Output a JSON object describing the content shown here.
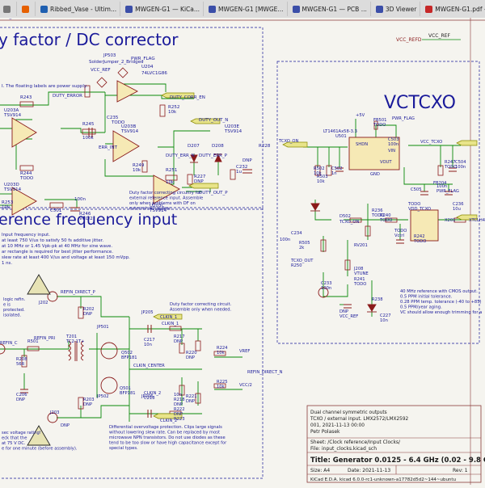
{
  "taskbar": {
    "items": [
      {
        "label": "",
        "icon": "window-icon",
        "color": "#777777"
      },
      {
        "label": "",
        "icon": "firefox-icon",
        "color": "#e66000"
      },
      {
        "label": "Ribbed_Vase - Ultim...",
        "icon": "ultimaker-icon",
        "color": "#1f5fb0"
      },
      {
        "label": "MWGEN-G1 — KiCa...",
        "icon": "kicad-icon",
        "color": "#3b4ea8"
      },
      {
        "label": "MWGEN-G1 [MWGE...",
        "icon": "kicad-icon",
        "color": "#3b4ea8"
      },
      {
        "label": "MWGEN-G1 — PCB ...",
        "icon": "kicad-icon",
        "color": "#3b4ea8"
      },
      {
        "label": "3D Viewer",
        "icon": "kicad-icon",
        "color": "#3b4ea8"
      },
      {
        "label": "MWGEN-G1.pdf — G...",
        "icon": "pdf-icon",
        "color": "#c62828"
      }
    ]
  },
  "schematic": {
    "colors": {
      "background": "#f5f4ef",
      "wire": "#0a8a0a",
      "frame": "#8a3a3a",
      "text": "#1a1a9a",
      "component": "#8a1a1a",
      "label": "#8a8a00"
    },
    "section_titles": {
      "duty": "y factor / DC corrector",
      "vctcxo": "VCTCXO",
      "reference": "erence frequency input"
    },
    "duty_notes": [
      "I. The floating labels are power supply."
    ],
    "duty_labels": [
      "JP503",
      "SolderJumper_2_Bridged",
      "PWR_FLAG",
      "VCC_REF",
      "U204",
      "74LVC1G86",
      "R243",
      "DUTY_ERROR",
      "DUTY_CORR_EN",
      "U203A",
      "TSV914",
      "R252",
      "10k",
      "R245",
      "100k",
      "C235",
      "TODO",
      "DUTY_OUT_N",
      "U203E",
      "TSV914",
      "U203B",
      "TSV914",
      "ERR_INT",
      "D207",
      "D208",
      "DUTY_ERR_N",
      "DUTY_ERR_P",
      "R244",
      "TODO",
      "R249",
      "10k",
      "R227",
      "DNP",
      "R251",
      "10k",
      "DUTY_OUT_P",
      "U203D",
      "TSV914",
      "U203C",
      "TSV914",
      "C501",
      "100n",
      "R246",
      "VCC/2",
      "C232",
      "1u",
      "R253",
      "10k",
      "R228",
      "DNP",
      "GND",
      "VCC_REF"
    ],
    "duty_footnote": [
      "Duty factor correcting circuitry for",
      "external reference input. Assemble",
      "only when problems with DF on",
      "external ref. appear."
    ],
    "vctcxo_labels": [
      "+5V",
      "FB501",
      "TODO",
      "PWR_FLAG",
      "LT1461Ax58-3.3",
      "U501",
      "VCC_TCXO",
      "C503",
      "100n",
      "SHDN",
      "VIN",
      "VOUT",
      "GND",
      "TCXO_ON",
      "R502",
      "10k",
      "R503",
      "10k",
      "C502",
      "1n",
      "R247",
      "TODO",
      "C504",
      "100n",
      "C505",
      "100n",
      "PWR_FLAG",
      "FB204",
      "TODO",
      "VDD_TCXO",
      "C236",
      "10u",
      "C234",
      "100n",
      "D502",
      "TCXO_ON",
      "R236",
      "TODO",
      "R240",
      "TODO",
      "R242",
      "TODO",
      "X201",
      "XTCLH40M000CHJA0P0",
      "TCXO_OUT",
      "R250",
      "R505",
      "2k",
      "RV201",
      "TODO",
      "Vctrl",
      "C233",
      "100n",
      "J208",
      "VTUNE",
      "R241",
      "TODO",
      "R238",
      "DNP",
      "VCC_REF",
      "C227",
      "10n",
      "D501",
      "BAT54S"
    ],
    "vctcxo_notes": [
      "40 MHz reference with CMOS output.",
      "0.5 PPM initial tolerance.",
      "0.28 PPM temp. tolerance (-40 to +85)",
      "0.5 PPM/year aging.",
      "VC should allow enough trimming for a"
    ],
    "reference_notes": [
      "Input frequency input.",
      "at least 750 V/us to satisfy 50 fs additive jitter.",
      "at 10 MHz or 1.45 Vpk-pk at 40 MHz for sine wave.",
      "ar rectangle is required for best jitter performance.",
      "slew rate at least 400 V/us and voltage at least 150 mVpp.",
      "1 ns."
    ],
    "reference_labels": [
      "REFIN_DIRECT_P",
      "J202",
      "R202",
      "DNP",
      "JP501",
      "JP205",
      "CLKIN_1",
      "CLKIN_1",
      "C217",
      "10n",
      "R217",
      "DNP",
      "R501",
      "REFIN_C",
      "REFIN_PRI",
      "T201",
      "TC2-1T+",
      "R208",
      "56R",
      "Q502",
      "BFP181",
      "R220",
      "DNP",
      "R224",
      "10k",
      "VREF",
      "CLKIN_CENTER",
      "Q501",
      "BFP181",
      "R221",
      "DNP",
      "R225",
      "10k",
      "VCC/2",
      "C206",
      "DNP",
      "J203",
      "R203",
      "DNP",
      "JP502",
      "JP206",
      "CLKIN_2",
      "CLKIN_2",
      "C218",
      "10n",
      "R218",
      "DNP",
      "R222",
      "DNP",
      "R223",
      "DNP",
      "REFIN_DIRECT_N",
      "GND"
    ],
    "reference_warnings": [
      "logic refin.",
      "e is",
      "protected.",
      "isolated."
    ],
    "reference_footnotes": [
      "Duty factor correcting circuit.",
      "Assemble only when needed."
    ],
    "reference_bottom_notes": [
      "Differential overvoltage protection. Clips large signals",
      "without lowering slew rate. Can be replaced by most",
      "microwave NPN transistors. Do not use diodes as these",
      "tend to be too slow or have high capacitance except for",
      "special types."
    ],
    "reference_left_notes": [
      "sec voltage rating!",
      "eck that the",
      "at 75 V DC.",
      "e for one minute (before assembly)."
    ]
  },
  "title_block": {
    "description_lines": [
      "Dual channel symmetric outputs",
      "TCXO / external input. LMX2572/LMX2592",
      "001, 2021-11-13 00:00",
      "Petr Polasek"
    ],
    "sheet": "Sheet: /Clock reference/Input Clocks/",
    "file": "File: input_clocks.kicad_sch",
    "title": "Title: Generator 0.0125 - 6.4 GHz (0.02 - 9.8 G",
    "size": "Size: A4",
    "date": "Date: 2021-11-13",
    "rev": "Rev: 1",
    "kicad": "KiCad E.D.A.  kicad 6.0.0-rc1-unknown-a17782d5d2~144~ubuntu"
  },
  "labels_top": {
    "vcc_refd": "VCC_REFD",
    "vcc_ref": "VCC_REF"
  }
}
